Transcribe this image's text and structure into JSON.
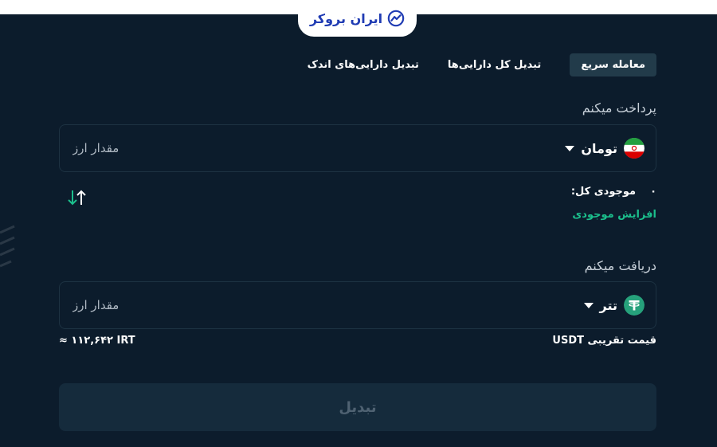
{
  "brand": {
    "name": "ایران بروکر",
    "color": "#1f3bb3"
  },
  "tabs": [
    {
      "label": "معامله سریع",
      "active": true
    },
    {
      "label": "تبدیل کل دارایی‌ها",
      "active": false
    },
    {
      "label": "تبدیل دارایی‌های اندک",
      "active": false
    }
  ],
  "pay": {
    "label": "پرداخت میکنم",
    "currency": "تومان",
    "currency_icon": "iran-flag-icon",
    "placeholder": "مقدار ارز"
  },
  "balance": {
    "label": "موجودی کل:",
    "value": "۰",
    "increase_label": "افزایش موجودی"
  },
  "receive": {
    "label": "دریافت میکنم",
    "currency": "تتر",
    "currency_icon": "tether-icon",
    "placeholder": "مقدار ارز"
  },
  "rate": {
    "label": "قیمت تقریبی USDT",
    "value": "≈ ۱۱۲,۶۴۲ IRT"
  },
  "submit_label": "تبدیل",
  "colors": {
    "background": "#0c1c2c",
    "accent_green": "#1bbf8c",
    "tab_active": "#223b4a",
    "button_disabled": "#152b3c"
  }
}
